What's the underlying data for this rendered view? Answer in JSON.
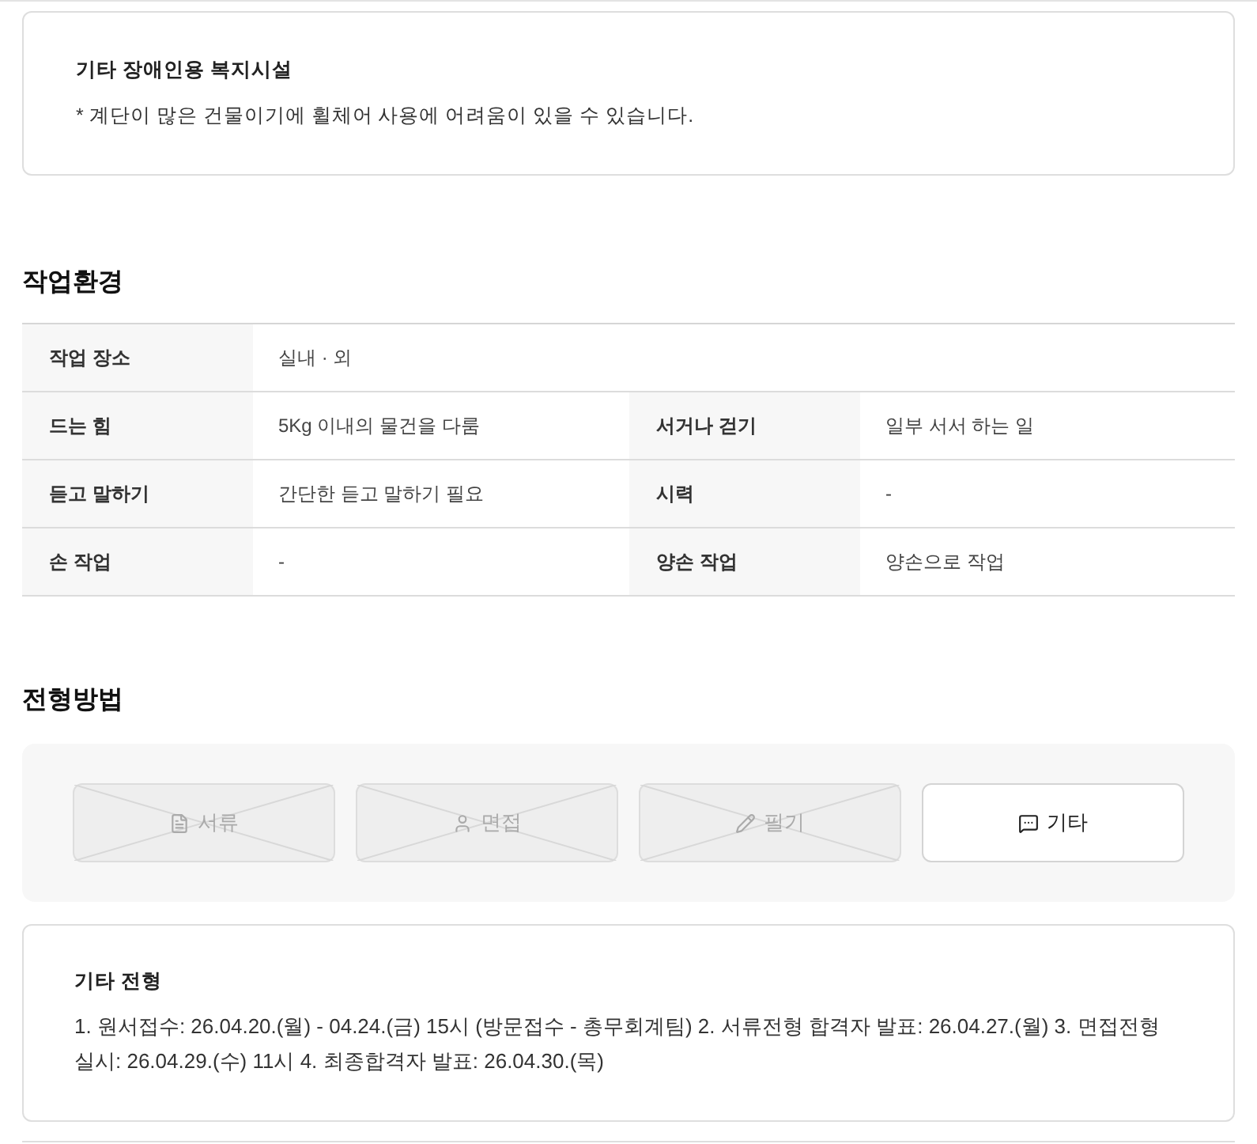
{
  "facility_card": {
    "title": "기타 장애인용 복지시설",
    "note": "* 계단이 많은 건물이기에 휠체어 사용에 어려움이 있을 수 있습니다."
  },
  "work_environment": {
    "title": "작업환경",
    "rows": [
      {
        "cells": [
          {
            "label": "작업 장소",
            "value": "실내 · 외"
          }
        ]
      },
      {
        "cells": [
          {
            "label": "드는 힘",
            "value": "5Kg 이내의 물건을 다룸"
          },
          {
            "label": "서거나 걷기",
            "value": "일부 서서 하는 일"
          }
        ]
      },
      {
        "cells": [
          {
            "label": "듣고 말하기",
            "value": "간단한 듣고 말하기 필요"
          },
          {
            "label": "시력",
            "value": "-"
          }
        ]
      },
      {
        "cells": [
          {
            "label": "손 작업",
            "value": "-"
          },
          {
            "label": "양손 작업",
            "value": "양손으로 작업"
          }
        ]
      }
    ]
  },
  "selection_method": {
    "title": "전형방법",
    "options": [
      {
        "label": "서류",
        "selected": false
      },
      {
        "label": "면접",
        "selected": false
      },
      {
        "label": "필기",
        "selected": false
      },
      {
        "label": "기타",
        "selected": true
      }
    ],
    "detail": {
      "title": "기타 전형",
      "text": "1. 원서접수: 26.04.20.(월) - 04.24.(금) 15시 (방문접수 - 총무회계팀) 2. 서류전형 합격자 발표: 26.04.27.(월) 3. 면접전형 실시: 26.04.29.(수) 11시 4. 최종합격자 발표: 26.04.30.(목)"
    }
  }
}
